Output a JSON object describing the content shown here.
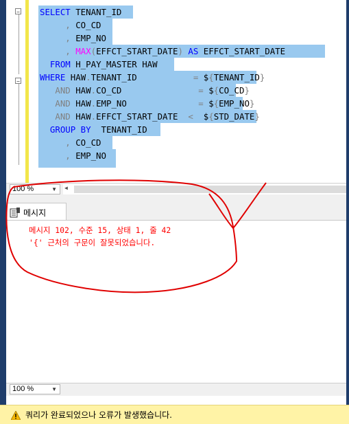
{
  "editor": {
    "lines": [
      {
        "parts": [
          {
            "t": "SELECT",
            "c": "kw"
          },
          {
            "t": " TENANT_ID",
            "c": "id"
          }
        ]
      },
      {
        "parts": [
          {
            "t": "     , ",
            "c": "gr"
          },
          {
            "t": "CO_CD",
            "c": "id"
          }
        ]
      },
      {
        "parts": [
          {
            "t": "     , ",
            "c": "gr"
          },
          {
            "t": "EMP_NO",
            "c": "id"
          }
        ]
      },
      {
        "parts": [
          {
            "t": "     , ",
            "c": "gr"
          },
          {
            "t": "MAX",
            "c": "fn"
          },
          {
            "t": "(",
            "c": "gr"
          },
          {
            "t": "EFFCT_START_DATE",
            "c": "id"
          },
          {
            "t": ")",
            "c": "gr"
          },
          {
            "t": " AS ",
            "c": "kw"
          },
          {
            "t": "EFFCT_START_DATE",
            "c": "id"
          }
        ]
      },
      {
        "parts": [
          {
            "t": "  ",
            "c": "id"
          },
          {
            "t": "FROM",
            "c": "kw"
          },
          {
            "t": " H_PAY_MASTER HAW",
            "c": "id"
          }
        ]
      },
      {
        "parts": [
          {
            "t": "WHERE",
            "c": "kw"
          },
          {
            "t": " HAW",
            "c": "id"
          },
          {
            "t": ".",
            "c": "gr"
          },
          {
            "t": "TENANT_ID           ",
            "c": "id"
          },
          {
            "t": "=",
            "c": "gr"
          },
          {
            "t": " $",
            "c": "id"
          },
          {
            "t": "{",
            "c": "gr"
          },
          {
            "t": "TENANT_ID",
            "c": "id"
          },
          {
            "t": "}",
            "c": "gr"
          }
        ]
      },
      {
        "parts": [
          {
            "t": "   AND",
            "c": "gr"
          },
          {
            "t": " HAW",
            "c": "id"
          },
          {
            "t": ".",
            "c": "gr"
          },
          {
            "t": "CO_CD               ",
            "c": "id"
          },
          {
            "t": "=",
            "c": "gr"
          },
          {
            "t": " $",
            "c": "id"
          },
          {
            "t": "{",
            "c": "gr"
          },
          {
            "t": "CO_CD",
            "c": "id"
          },
          {
            "t": "}",
            "c": "gr"
          }
        ]
      },
      {
        "parts": [
          {
            "t": "   AND",
            "c": "gr"
          },
          {
            "t": " HAW",
            "c": "id"
          },
          {
            "t": ".",
            "c": "gr"
          },
          {
            "t": "EMP_NO              ",
            "c": "id"
          },
          {
            "t": "=",
            "c": "gr"
          },
          {
            "t": " $",
            "c": "id"
          },
          {
            "t": "{",
            "c": "gr"
          },
          {
            "t": "EMP_NO",
            "c": "id"
          },
          {
            "t": "}",
            "c": "gr"
          }
        ]
      },
      {
        "parts": [
          {
            "t": "   AND",
            "c": "gr"
          },
          {
            "t": " HAW",
            "c": "id"
          },
          {
            "t": ".",
            "c": "gr"
          },
          {
            "t": "EFFCT_START_DATE  ",
            "c": "id"
          },
          {
            "t": "<",
            "c": "gr"
          },
          {
            "t": "  $",
            "c": "id"
          },
          {
            "t": "{",
            "c": "gr"
          },
          {
            "t": "STD_DATE",
            "c": "id"
          },
          {
            "t": "}",
            "c": "gr"
          }
        ]
      },
      {
        "parts": [
          {
            "t": "  GROUP BY",
            "c": "kw"
          },
          {
            "t": "  TENANT_ID",
            "c": "id"
          }
        ]
      },
      {
        "parts": [
          {
            "t": "     , ",
            "c": "gr"
          },
          {
            "t": "CO_CD",
            "c": "id"
          }
        ]
      },
      {
        "parts": [
          {
            "t": "     , ",
            "c": "gr"
          },
          {
            "t": "EMP_NO",
            "c": "id"
          }
        ]
      }
    ]
  },
  "zoom_top": {
    "value": "100 %"
  },
  "results": {
    "tab_label": "메시지",
    "messages": [
      "메시지 102, 수준 15, 상태 1, 줄 42",
      "'{' 근처의 구문이 잘못되었습니다."
    ]
  },
  "zoom_bottom": {
    "value": "100 %"
  },
  "status": {
    "text": "쿼리가 완료되었으나 오류가 발생했습니다."
  },
  "colors": {
    "selection": "#99c9ef",
    "keyword": "#0000ff",
    "function": "#ff00ff",
    "error": "#ff0000",
    "statusbar": "#fff3a6",
    "frame": "#1f3d6b"
  }
}
